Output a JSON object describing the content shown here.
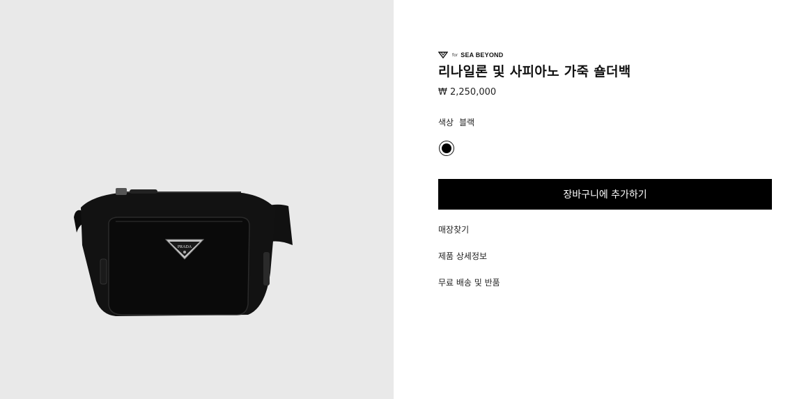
{
  "product": {
    "brand_for": "for",
    "brand_logo": "SEA BEYOND",
    "title": "리나일론 및 사피아노 가죽 숄더백",
    "price": "₩ 2,250,000",
    "color_label": "색상",
    "color_value": "블랙",
    "swatch_color": "#000000"
  },
  "actions": {
    "add_to_cart": "장바구니에 추가하기"
  },
  "links": {
    "store": "매장찾기",
    "details": "제품 상세정보",
    "shipping": "무료 배송 및 반품"
  },
  "image": {
    "plaque_text": "PRADA"
  }
}
